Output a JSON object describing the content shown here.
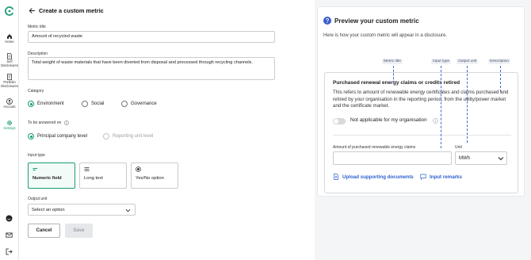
{
  "sidebar": {
    "items": [
      {
        "label": "Home",
        "icon": "home-icon"
      },
      {
        "label": "Self Disclosures",
        "icon": "document-icon"
      },
      {
        "label": "Portfolio Disclosures",
        "icon": "portfolio-icon"
      },
      {
        "label": "Account",
        "icon": "user-icon"
      },
      {
        "label": "Settings",
        "icon": "gear-icon",
        "active": true
      }
    ],
    "bottom_icons": [
      "help-chat-icon",
      "mail-icon",
      "logout-icon"
    ]
  },
  "form": {
    "page_title": "Create a custom metric",
    "metric_title_label": "Metric title",
    "metric_title_value": "Amount of recycled waste",
    "description_label": "Description",
    "description_value": "Total weight of waste materials that have been diverted from disposal and processed through recycling channels.",
    "category_label": "Category",
    "category_options": [
      "Environment",
      "Social",
      "Governance"
    ],
    "category_selected": "Environment",
    "answered_label": "To be answered on",
    "answered_options": [
      "Principal company level",
      "Reporting unit level"
    ],
    "answered_selected": "Principal company level",
    "input_type_label": "Input type",
    "input_types": [
      "Numeric field",
      "Long text",
      "Yes/No option"
    ],
    "input_type_selected": "Numeric field",
    "output_unit_label": "Output unit",
    "output_unit_placeholder": "Select an option",
    "cancel_label": "Cancel",
    "save_label": "Save"
  },
  "preview": {
    "title": "Preview your custom metric",
    "subtitle": "Here is how your custom metric will appear in a disclosure.",
    "tags": [
      "Metric title",
      "Input type",
      "Output unit",
      "Description"
    ],
    "card_title": "Purchased renewal energy claims or credits retired",
    "card_description": "This refers to amount of renewable energy certificates and claims purchased and retired by your organisation in the reporting period, from the utility/power market and the certificate market.",
    "not_applicable_label": "Not applicable for my organisation",
    "amount_label": "Amount of purchased renewable energy claims",
    "unit_label": "Unit",
    "unit_value": "MWh",
    "upload_label": "Upload supporting documents",
    "remarks_label": "Input remarks"
  },
  "colors": {
    "accent": "#1a9c77",
    "link": "#2b5fd0",
    "help_icon": "#3a5cc9"
  }
}
